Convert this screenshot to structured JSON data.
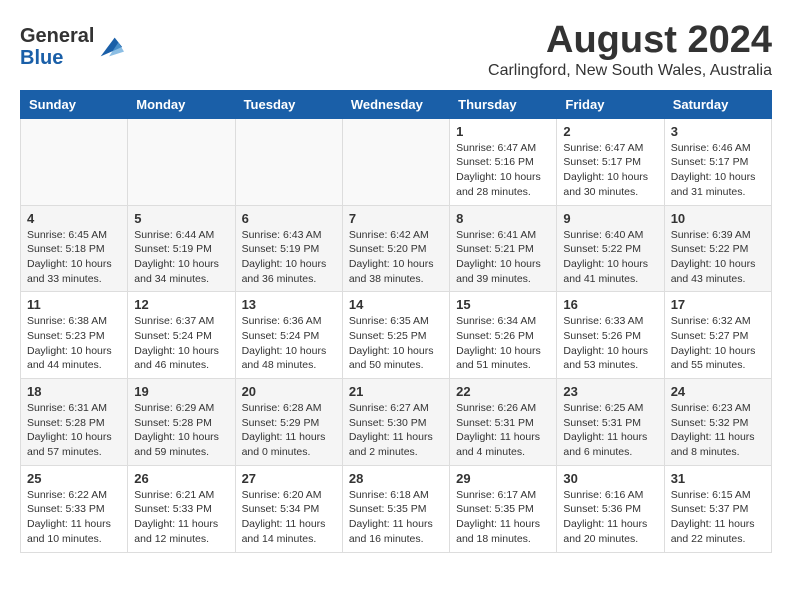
{
  "header": {
    "logo_general": "General",
    "logo_blue": "Blue",
    "month_year": "August 2024",
    "location": "Carlingford, New South Wales, Australia"
  },
  "weekdays": [
    "Sunday",
    "Monday",
    "Tuesday",
    "Wednesday",
    "Thursday",
    "Friday",
    "Saturday"
  ],
  "weeks": [
    [
      {
        "day": "",
        "info": ""
      },
      {
        "day": "",
        "info": ""
      },
      {
        "day": "",
        "info": ""
      },
      {
        "day": "",
        "info": ""
      },
      {
        "day": "1",
        "info": "Sunrise: 6:47 AM\nSunset: 5:16 PM\nDaylight: 10 hours\nand 28 minutes."
      },
      {
        "day": "2",
        "info": "Sunrise: 6:47 AM\nSunset: 5:17 PM\nDaylight: 10 hours\nand 30 minutes."
      },
      {
        "day": "3",
        "info": "Sunrise: 6:46 AM\nSunset: 5:17 PM\nDaylight: 10 hours\nand 31 minutes."
      }
    ],
    [
      {
        "day": "4",
        "info": "Sunrise: 6:45 AM\nSunset: 5:18 PM\nDaylight: 10 hours\nand 33 minutes."
      },
      {
        "day": "5",
        "info": "Sunrise: 6:44 AM\nSunset: 5:19 PM\nDaylight: 10 hours\nand 34 minutes."
      },
      {
        "day": "6",
        "info": "Sunrise: 6:43 AM\nSunset: 5:19 PM\nDaylight: 10 hours\nand 36 minutes."
      },
      {
        "day": "7",
        "info": "Sunrise: 6:42 AM\nSunset: 5:20 PM\nDaylight: 10 hours\nand 38 minutes."
      },
      {
        "day": "8",
        "info": "Sunrise: 6:41 AM\nSunset: 5:21 PM\nDaylight: 10 hours\nand 39 minutes."
      },
      {
        "day": "9",
        "info": "Sunrise: 6:40 AM\nSunset: 5:22 PM\nDaylight: 10 hours\nand 41 minutes."
      },
      {
        "day": "10",
        "info": "Sunrise: 6:39 AM\nSunset: 5:22 PM\nDaylight: 10 hours\nand 43 minutes."
      }
    ],
    [
      {
        "day": "11",
        "info": "Sunrise: 6:38 AM\nSunset: 5:23 PM\nDaylight: 10 hours\nand 44 minutes."
      },
      {
        "day": "12",
        "info": "Sunrise: 6:37 AM\nSunset: 5:24 PM\nDaylight: 10 hours\nand 46 minutes."
      },
      {
        "day": "13",
        "info": "Sunrise: 6:36 AM\nSunset: 5:24 PM\nDaylight: 10 hours\nand 48 minutes."
      },
      {
        "day": "14",
        "info": "Sunrise: 6:35 AM\nSunset: 5:25 PM\nDaylight: 10 hours\nand 50 minutes."
      },
      {
        "day": "15",
        "info": "Sunrise: 6:34 AM\nSunset: 5:26 PM\nDaylight: 10 hours\nand 51 minutes."
      },
      {
        "day": "16",
        "info": "Sunrise: 6:33 AM\nSunset: 5:26 PM\nDaylight: 10 hours\nand 53 minutes."
      },
      {
        "day": "17",
        "info": "Sunrise: 6:32 AM\nSunset: 5:27 PM\nDaylight: 10 hours\nand 55 minutes."
      }
    ],
    [
      {
        "day": "18",
        "info": "Sunrise: 6:31 AM\nSunset: 5:28 PM\nDaylight: 10 hours\nand 57 minutes."
      },
      {
        "day": "19",
        "info": "Sunrise: 6:29 AM\nSunset: 5:28 PM\nDaylight: 10 hours\nand 59 minutes."
      },
      {
        "day": "20",
        "info": "Sunrise: 6:28 AM\nSunset: 5:29 PM\nDaylight: 11 hours\nand 0 minutes."
      },
      {
        "day": "21",
        "info": "Sunrise: 6:27 AM\nSunset: 5:30 PM\nDaylight: 11 hours\nand 2 minutes."
      },
      {
        "day": "22",
        "info": "Sunrise: 6:26 AM\nSunset: 5:31 PM\nDaylight: 11 hours\nand 4 minutes."
      },
      {
        "day": "23",
        "info": "Sunrise: 6:25 AM\nSunset: 5:31 PM\nDaylight: 11 hours\nand 6 minutes."
      },
      {
        "day": "24",
        "info": "Sunrise: 6:23 AM\nSunset: 5:32 PM\nDaylight: 11 hours\nand 8 minutes."
      }
    ],
    [
      {
        "day": "25",
        "info": "Sunrise: 6:22 AM\nSunset: 5:33 PM\nDaylight: 11 hours\nand 10 minutes."
      },
      {
        "day": "26",
        "info": "Sunrise: 6:21 AM\nSunset: 5:33 PM\nDaylight: 11 hours\nand 12 minutes."
      },
      {
        "day": "27",
        "info": "Sunrise: 6:20 AM\nSunset: 5:34 PM\nDaylight: 11 hours\nand 14 minutes."
      },
      {
        "day": "28",
        "info": "Sunrise: 6:18 AM\nSunset: 5:35 PM\nDaylight: 11 hours\nand 16 minutes."
      },
      {
        "day": "29",
        "info": "Sunrise: 6:17 AM\nSunset: 5:35 PM\nDaylight: 11 hours\nand 18 minutes."
      },
      {
        "day": "30",
        "info": "Sunrise: 6:16 AM\nSunset: 5:36 PM\nDaylight: 11 hours\nand 20 minutes."
      },
      {
        "day": "31",
        "info": "Sunrise: 6:15 AM\nSunset: 5:37 PM\nDaylight: 11 hours\nand 22 minutes."
      }
    ]
  ]
}
